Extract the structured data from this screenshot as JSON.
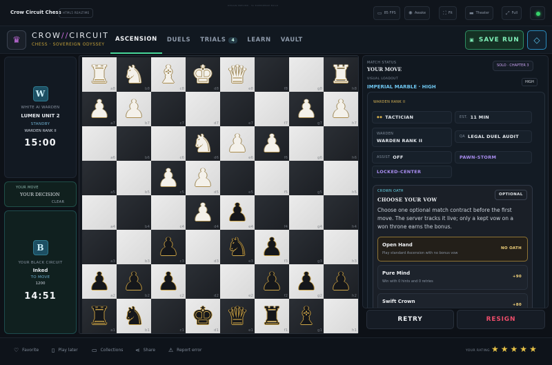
{
  "topbar": {
    "app_title": "Crow Circuit Chess",
    "mode_badge": "HTML5 REALTIME",
    "center_text": "DESIGN PREVIEW · 5x EXPERIENCE BUILD",
    "buttons": [
      {
        "label": "85 FPS",
        "icon": "monitor-icon"
      },
      {
        "label": "Awake",
        "icon": "sun-icon"
      },
      {
        "label": "Fit",
        "icon": "fit-icon"
      },
      {
        "label": "Theater",
        "icon": "theater-icon"
      },
      {
        "label": "Full",
        "icon": "fullscreen-icon"
      }
    ],
    "status_color": "#36d36b"
  },
  "header": {
    "brand_left": "CROW",
    "brand_sep": "//",
    "brand_right": "CIRCUIT",
    "brand_sub": "CHESS · SOVEREIGN ODYSSEY",
    "tabs": [
      {
        "label": "ASCENSION",
        "active": true
      },
      {
        "label": "DUELS"
      },
      {
        "label": "TRIALS",
        "badge": "4"
      },
      {
        "label": "LEARN"
      },
      {
        "label": "VAULT"
      }
    ],
    "save_label": "SAVE RUN",
    "accent": "#47d79a"
  },
  "players": {
    "white": {
      "initial": "W",
      "role": "WHITE AI WARDEN",
      "name": "LUMEN UNIT 2",
      "status": "STANDBY",
      "rank": "WARDEN RANK II",
      "clock": "15:00"
    },
    "black": {
      "initial": "B",
      "role": "YOUR BLACK CIRCUIT",
      "name": "Inked",
      "status": "TO MOVE",
      "rank": "1200",
      "clock": "14:51"
    }
  },
  "turn": {
    "label": "YOUR MOVE",
    "value": "YOUR DECISION",
    "clear_label": "CLEAR"
  },
  "board": {
    "files": [
      "a",
      "b",
      "c",
      "d",
      "e",
      "f",
      "g",
      "h"
    ],
    "rows": [
      [
        "wR",
        "wN",
        "wB",
        "wK",
        "wQ",
        "",
        "",
        "wR"
      ],
      [
        "wP",
        "wP",
        "",
        "",
        "",
        "",
        "wP",
        "wP"
      ],
      [
        "",
        "",
        "",
        "wN",
        "wP",
        "wP",
        "",
        ""
      ],
      [
        "",
        "",
        "wP",
        "wP",
        "",
        "",
        "",
        ""
      ],
      [
        "",
        "",
        "",
        "wP",
        "bP",
        "",
        "",
        ""
      ],
      [
        "",
        "",
        "bP",
        "",
        "bN",
        "bP",
        "",
        ""
      ],
      [
        "bP",
        "bP",
        "bP",
        "",
        "",
        "bP",
        "bP",
        "bP"
      ],
      [
        "bR",
        "bN",
        "",
        "bK",
        "bQ",
        "bR",
        "bB",
        ""
      ]
    ]
  },
  "panel": {
    "match_status_label": "MATCH STATUS",
    "match_status_value": "YOUR MOVE",
    "chapter_badge": "SOLO · CHAPTER 3",
    "loadout_label": "VISUAL LOADOUT",
    "loadout_value": "IMPERIAL MARBLE · HIGH",
    "quality_badge": "HIGH",
    "warden_rank": "WARDEN RANK II",
    "style": "TACTICIAN",
    "est_label": "EST.",
    "est_value": "11 MIN",
    "warden_label": "WARDEN",
    "warden_value": "WARDEN RANK II",
    "qa_label": "QA",
    "qa_value": "LEGAL DUEL AUDIT",
    "assist_label": "ASSIST",
    "assist_value": "OFF",
    "strategy": "PAWN-STORM",
    "opening": "LOCKED-CENTER",
    "oath": {
      "label": "CROWN OATH",
      "title": "CHOOSE YOUR VOW",
      "badge": "OPTIONAL",
      "description": "Choose one optional match contract before the first move. The server tracks it live; only a kept vow on a won throne earns the bonus.",
      "options": [
        {
          "name": "Open Hand",
          "desc": "Play standard Ascension with no bonus vow",
          "value": "NO OATH",
          "selected": true
        },
        {
          "name": "Pure Mind",
          "desc": "Win with 0 hints and 0 retries",
          "value": "+90"
        },
        {
          "name": "Swift Crown",
          "desc": "",
          "value": "+80"
        }
      ]
    }
  },
  "actions": {
    "retry": "RETRY",
    "resign": "RESIGN"
  },
  "footer": {
    "items": [
      {
        "label": "Favorite",
        "icon": "heart-icon"
      },
      {
        "label": "Play later",
        "icon": "bookmark-icon"
      },
      {
        "label": "Collections",
        "icon": "folder-icon"
      },
      {
        "label": "Share",
        "icon": "share-icon"
      },
      {
        "label": "Report error",
        "icon": "warning-icon"
      }
    ],
    "rating_label": "YOUR RATING",
    "rating": 5
  }
}
